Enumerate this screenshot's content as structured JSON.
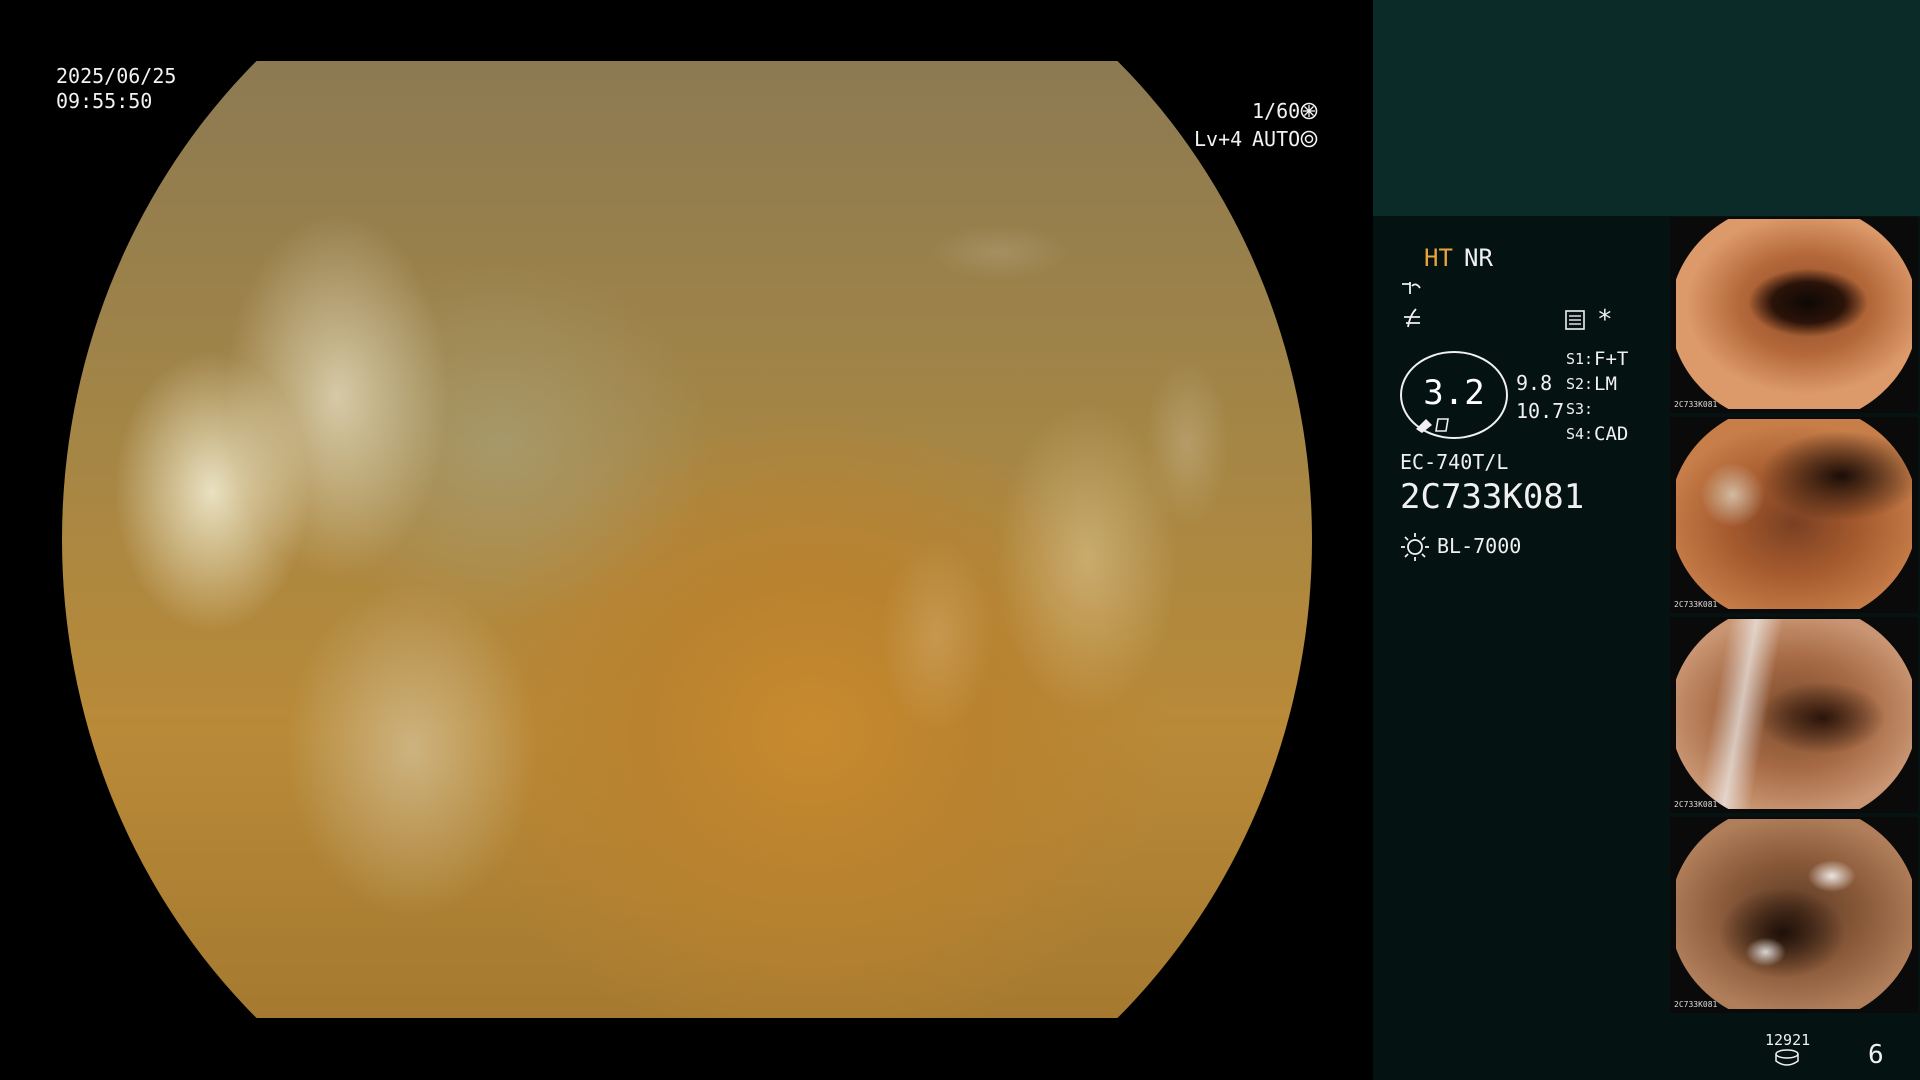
{
  "main": {
    "date": "2025/06/25",
    "time": "09:55:50",
    "shutter": "1/60",
    "level": "Lv+4",
    "exposure_mode": "AUTO"
  },
  "panel": {
    "ht": "HT",
    "nr": "NR",
    "zoom": "3.2",
    "value_upper": "9.8",
    "value_lower": "10.7",
    "switches": [
      {
        "key": "S1:",
        "value": "F+T"
      },
      {
        "key": "S2:",
        "value": "LM"
      },
      {
        "key": "S3:",
        "value": ""
      },
      {
        "key": "S4:",
        "value": "CAD"
      }
    ],
    "scope_model": "EC-740T/L",
    "scope_serial": "2C733K081",
    "light_source": "BL-7000",
    "capture_count": "12921",
    "page": "6",
    "asterisk": "*"
  },
  "thumbnails": [
    {
      "id": "2C733K081"
    },
    {
      "id": "2C733K081"
    },
    {
      "id": "2C733K081"
    },
    {
      "id": "2C733K081"
    }
  ],
  "colors": {
    "accent": "#e8a43a",
    "panel_top": "#0b2b29",
    "panel_body": "#041311"
  }
}
